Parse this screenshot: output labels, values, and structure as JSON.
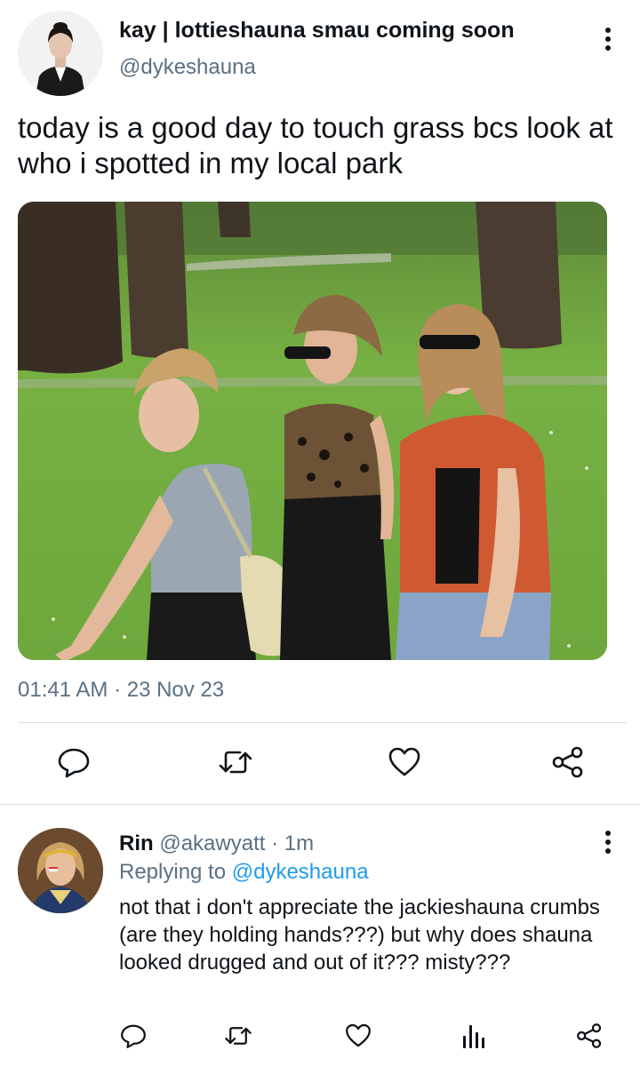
{
  "main_tweet": {
    "display_name": "kay | lottieshauna smau coming soon",
    "handle": "@dykeshauna",
    "text": "today is a good day to touch grass bcs look at who i spotted in my local park",
    "media_description": "three women walking in a sunny park",
    "timestamp": "01:41 AM · 23 Nov 23",
    "actions": [
      "reply-icon",
      "retweet-icon",
      "like-icon",
      "share-icon"
    ]
  },
  "reply_tweet": {
    "display_name": "Rin",
    "handle_time": "@akawyatt · 1m",
    "replying_prefix": "Replying to",
    "replying_to": "@dykeshauna",
    "text": "not that i don't appreciate the jackieshauna crumbs (are they holding hands???) but why does shauna looked drugged and out of it??? misty???",
    "actions": [
      "reply-icon",
      "retweet-icon",
      "like-icon",
      "analytics-icon",
      "share-icon"
    ]
  },
  "colors": {
    "text": "#0f1419",
    "secondary": "#5b7083",
    "link": "#1d9bf0",
    "divider": "#d9dee2"
  }
}
